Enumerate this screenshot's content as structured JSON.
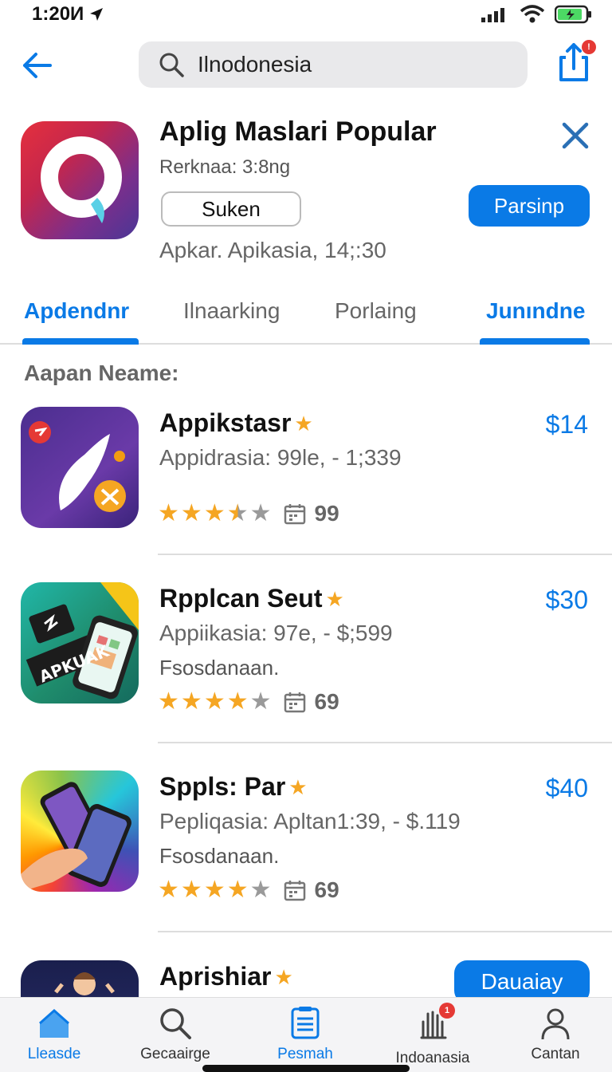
{
  "status": {
    "time": "1:20И"
  },
  "search": {
    "query": "Ilnodonesia"
  },
  "share": {
    "badge": "!"
  },
  "hero": {
    "title": "Aplig Maslari Popular",
    "subtitle": "Rerknaa: 3:8ng",
    "secondary_button": "Suken",
    "primary_button": "Parsinp",
    "meta": "Apkar. Apikasia, 14;:30"
  },
  "tabs": [
    {
      "label": "Apdendnr",
      "active": true
    },
    {
      "label": "Ilnaarking",
      "active": false
    },
    {
      "label": "Porlaing",
      "active": false
    },
    {
      "label": "Junındne",
      "active": true
    }
  ],
  "section_label": "Aapan Neame:",
  "apps": [
    {
      "name": "Appikstasr",
      "price": "$14",
      "desc": "Appidrasia: 99le, - 1;339",
      "desc2": "",
      "rating": 3.5,
      "count": "99"
    },
    {
      "name": "Rpplcan Seut",
      "price": "$30",
      "desc": "Appiikasia: 97e, - $;599",
      "desc2": "Fsosdanaan.",
      "rating": 4,
      "count": "69"
    },
    {
      "name": "Sppls: Par",
      "price": "$40",
      "desc": "Pepliqasia: Apltan1:39, - $.119",
      "desc2": "Fsosdanaan.",
      "rating": 4,
      "count": "69"
    },
    {
      "name": "Aprishiar",
      "price": "",
      "desc": "",
      "desc2": "",
      "rating": 0,
      "count": ""
    }
  ],
  "get_button": "Dauaiay",
  "tabbar": [
    {
      "label": "Lleasde",
      "icon": "home-icon",
      "active": true
    },
    {
      "label": "Gecaairge",
      "icon": "search-icon",
      "active": false
    },
    {
      "label": "Pesmah",
      "icon": "document-icon",
      "active": true
    },
    {
      "label": "Indoanasia",
      "icon": "hand-icon",
      "active": false,
      "badge": "1"
    },
    {
      "label": "Cantan",
      "icon": "person-icon",
      "active": false
    }
  ],
  "colors": {
    "accent": "#0a7ae6",
    "star": "#f5a623"
  }
}
